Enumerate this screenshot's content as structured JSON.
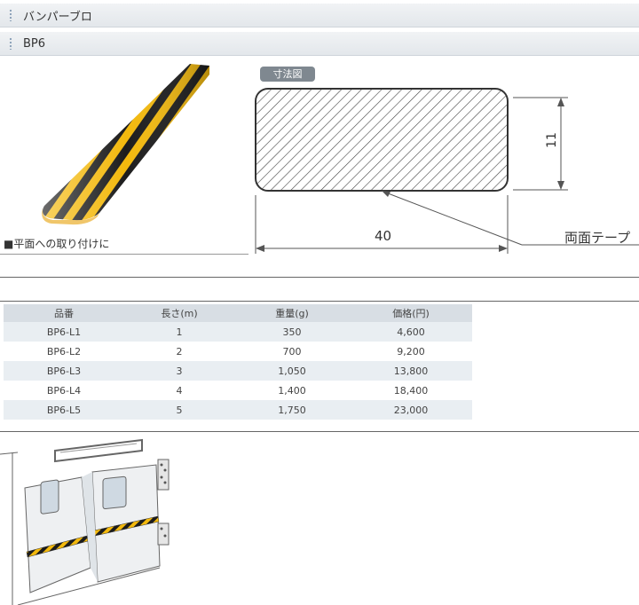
{
  "header": {
    "title": "バンパーブロ"
  },
  "subheader": {
    "title": "BP6"
  },
  "product": {
    "caption": "■平面への取り付けに"
  },
  "dimension": {
    "badge": "寸法図",
    "height_label": "11",
    "width_label": "40",
    "tape_label": "両面テープ"
  },
  "table": {
    "headers": [
      "品番",
      "長さ(m)",
      "重量(g)",
      "価格(円)"
    ],
    "rows": [
      [
        "BP6-L1",
        "1",
        "350",
        "4,600"
      ],
      [
        "BP6-L2",
        "2",
        "700",
        "9,200"
      ],
      [
        "BP6-L3",
        "3",
        "1,050",
        "13,800"
      ],
      [
        "BP6-L4",
        "4",
        "1,400",
        "18,400"
      ],
      [
        "BP6-L5",
        "5",
        "1,750",
        "23,000"
      ]
    ]
  },
  "colors": {
    "stripe_yellow": "#f3b90d",
    "stripe_black": "#1c1c1c",
    "header_bg": "#e6eaee",
    "table_header": "#d8dee4"
  }
}
